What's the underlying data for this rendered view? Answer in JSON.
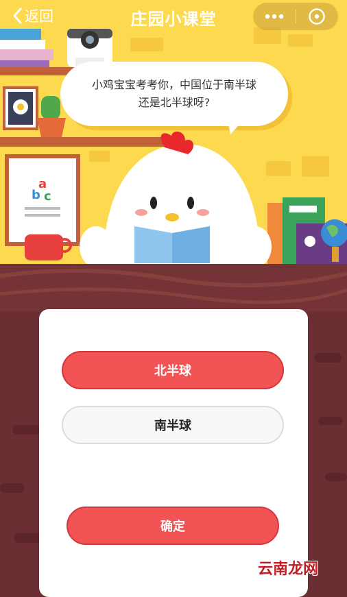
{
  "header": {
    "back_label": "返回",
    "title": "庄园小课堂",
    "more_icon": "more-dots-icon",
    "close_icon": "close-circle-icon"
  },
  "question": {
    "text_line1": "小鸡宝宝考考你，中国位于南半球",
    "text_line2": "还是北半球呀?"
  },
  "scene": {
    "poster_letters": [
      "a",
      "b",
      "c"
    ]
  },
  "options": [
    {
      "label": "北半球",
      "selected": true
    },
    {
      "label": "南半球",
      "selected": false
    }
  ],
  "confirm_label": "确定",
  "watermark": "云南龙网",
  "colors": {
    "background_yellow": "#fcd94f",
    "table_brown": "#6b2f33",
    "accent_red": "#f25456"
  }
}
